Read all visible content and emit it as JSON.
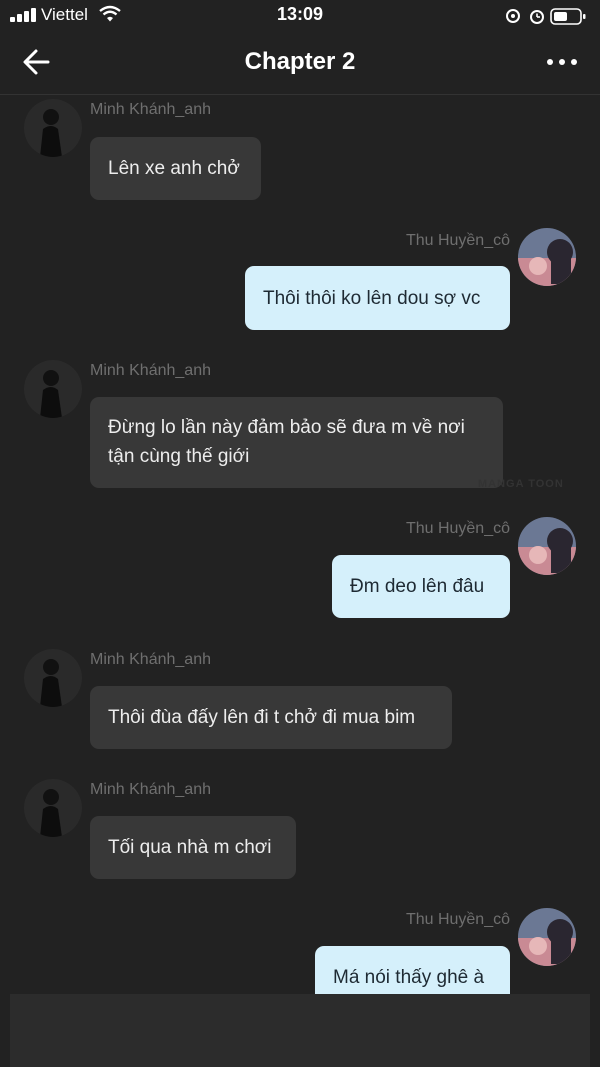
{
  "status_bar": {
    "carrier": "Viettel",
    "time": "13:09"
  },
  "header": {
    "title": "Chapter 2",
    "back_icon": "arrow-left-icon",
    "more_icon": "more-horizontal-icon"
  },
  "messages": [
    {
      "sender": "Minh Khánh_anh",
      "lines": [
        "Lên xe anh chở"
      ],
      "side": "in"
    },
    {
      "sender": "Thu Huyền_cô",
      "lines": [
        "Thôi thôi ko lên dou sợ vc"
      ],
      "side": "out"
    },
    {
      "sender": "Minh Khánh_anh",
      "lines": [
        "Đừng lo lần này đảm bảo sẽ đưa m về nơi",
        "tận cùng thế giới"
      ],
      "side": "in"
    },
    {
      "sender": "Thu Huyền_cô",
      "lines": [
        "Đm deo lên đâu"
      ],
      "side": "out"
    },
    {
      "sender": "Minh Khánh_anh",
      "lines": [
        "Thôi đùa đấy lên đi t chở đi mua bim"
      ],
      "side": "in"
    },
    {
      "sender": "Minh Khánh_anh",
      "lines": [
        "Tối qua nhà m chơi"
      ],
      "side": "in"
    },
    {
      "sender": "Thu Huyền_cô",
      "lines": [
        "Má nói thấy ghê à"
      ],
      "side": "out"
    }
  ],
  "colors": {
    "background": "#222222",
    "incoming_bubble": "#383838",
    "outgoing_bubble": "#d5f0fb",
    "sender_name": "#6f6f6f"
  }
}
